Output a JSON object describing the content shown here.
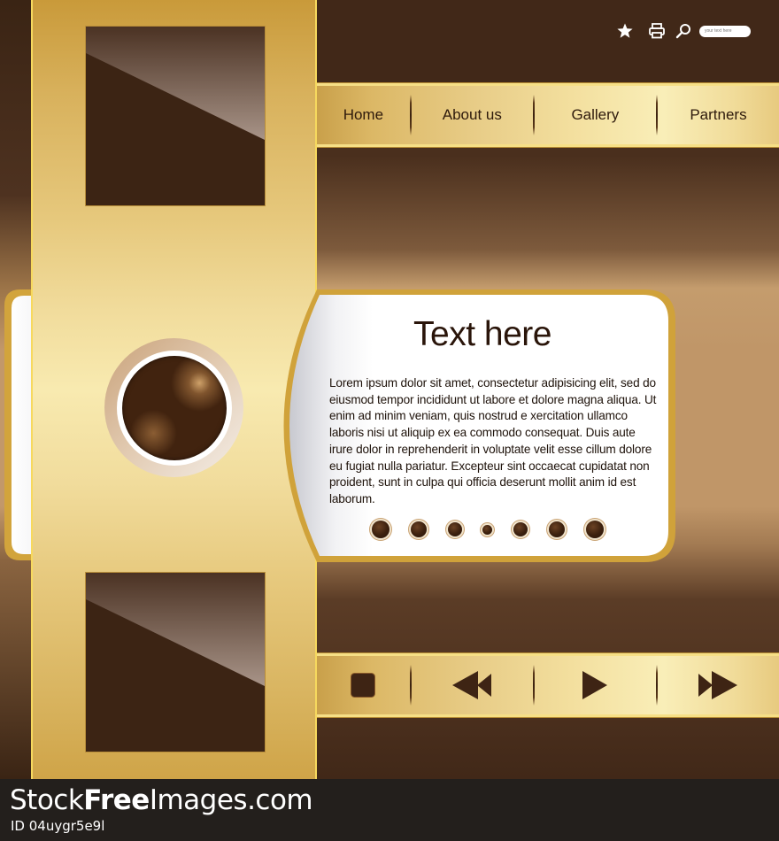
{
  "toolbar": {
    "icons": [
      "star-icon",
      "printer-icon",
      "search-icon"
    ],
    "search_placeholder": "your text here"
  },
  "nav": {
    "items": [
      {
        "label": "Home"
      },
      {
        "label": "About us"
      },
      {
        "label": "Gallery"
      },
      {
        "label": "Partners"
      }
    ]
  },
  "content": {
    "title": "Text here",
    "body": "Lorem ipsum dolor sit amet, consectetur adipisicing elit, sed do eiusmod tempor incididunt ut labore et dolore magna aliqua. Ut enim ad minim veniam, quis nostrud e xercitation ullamco laboris nisi ut aliquip ex ea commodo consequat. Duis aute irure dolor in reprehenderit in voluptate velit esse cillum dolore eu fugiat nulla pariatur. Excepteur sint occaecat cupidatat non proident, sunt in culpa qui officia deserunt mollit anim id est laborum.",
    "pagination_dots": 7,
    "active_dot": 4
  },
  "media_controls": [
    {
      "name": "stop",
      "icon": "stop-icon"
    },
    {
      "name": "rewind",
      "icon": "rewind-icon"
    },
    {
      "name": "play",
      "icon": "play-icon"
    },
    {
      "name": "fast-forward",
      "icon": "fast-forward-icon"
    }
  ],
  "colors": {
    "dark_brown": "#412818",
    "gold": "#e6c87c",
    "gold_highlight": "#f6df86",
    "text_dark": "#2a150a",
    "card_bg": "#ffffff"
  },
  "watermark": {
    "brand_prefix": "Stock",
    "brand_bold": "Free",
    "brand_suffix": "Images.com",
    "id": "ID 04uygr5e9l"
  }
}
